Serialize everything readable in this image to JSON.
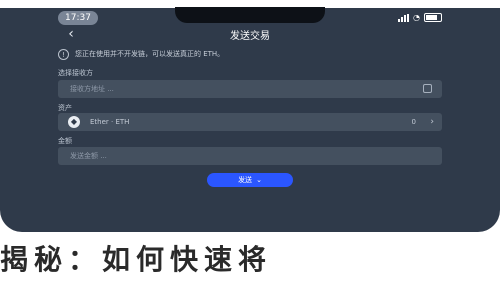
{
  "status": {
    "time": "17:37"
  },
  "header": {
    "title": "发送交易",
    "back_icon": "chevron-left-icon"
  },
  "notice": {
    "text": "您正在使用并不开发链，可以发送真正的 ETH。"
  },
  "address": {
    "label": "选择接收方",
    "placeholder": "接收方地址 ..."
  },
  "asset": {
    "label": "资产",
    "name": "Ether · ETH",
    "balance": "0",
    "icon": "ethereum-icon"
  },
  "amount": {
    "label": "金额",
    "placeholder": "发送金额 ..."
  },
  "send_button": {
    "label": "发送"
  },
  "headline": "揭秘：如何快速将"
}
